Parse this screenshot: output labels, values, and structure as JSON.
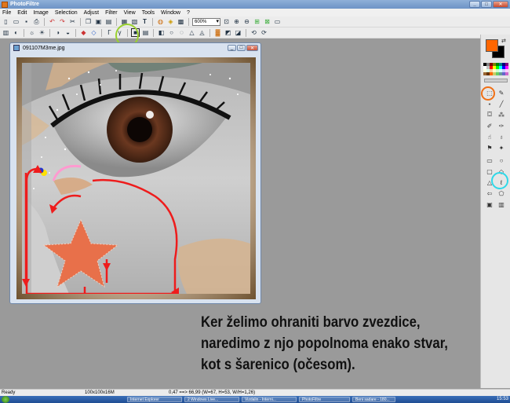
{
  "window": {
    "title": "PhotoFiltre"
  },
  "menu": [
    "File",
    "Edit",
    "Image",
    "Selection",
    "Adjust",
    "Filter",
    "View",
    "Tools",
    "Window",
    "?"
  ],
  "toolbar": {
    "zoom_value": "600%"
  },
  "document": {
    "filename": "091107M3me.jpg"
  },
  "caption": {
    "line1": "Ker želimo ohraniti barvo zvezdice,",
    "line2": "naredimo z njo popolnoma enako stvar,",
    "line3": "kot s šarenico (očesom)."
  },
  "status": {
    "left": "Ready",
    "size": "100x100x16M",
    "coords": "0,47 ==> 66,99 (W=67, H=53, W/H=1,26)"
  },
  "taskbar": {
    "tasks": [
      "Internet Explorer",
      "2 Windows Live...",
      "Vizdalin - Interni...",
      "PhotoFiltre",
      "Beni sadare - 180..."
    ],
    "clock": "15:53"
  },
  "colors": {
    "foreground": "#ff6600",
    "background": "#000000",
    "highlight_green": "#9ad12f",
    "highlight_orange": "#f07016",
    "highlight_cyan": "#2fd8e8",
    "annotation_red": "#ee1c1c"
  }
}
